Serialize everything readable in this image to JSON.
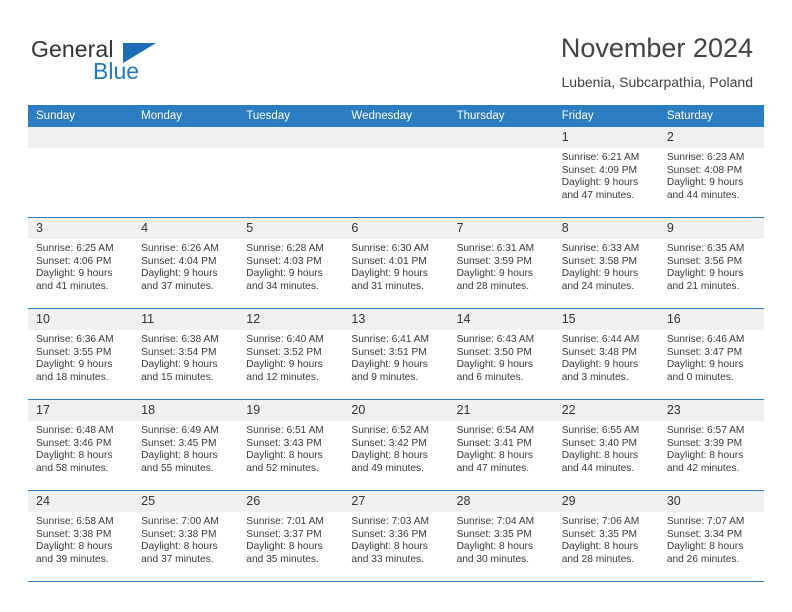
{
  "brand": {
    "name_top": "General",
    "name_bottom": "Blue",
    "triangle_color": "#1d6cb6",
    "blue_text_color": "#1f7ac4"
  },
  "header": {
    "title": "November 2024",
    "subtitle": "Lubenia, Subcarpathia, Poland"
  },
  "theme": {
    "header_blue": "#2b7cc0",
    "daynum_bg": "#f0f0f0",
    "text": "#333333"
  },
  "weekday_headers": [
    "Sunday",
    "Monday",
    "Tuesday",
    "Wednesday",
    "Thursday",
    "Friday",
    "Saturday"
  ],
  "weeks": [
    [
      {
        "day": "",
        "empty": true
      },
      {
        "day": "",
        "empty": true
      },
      {
        "day": "",
        "empty": true
      },
      {
        "day": "",
        "empty": true
      },
      {
        "day": "",
        "empty": true
      },
      {
        "day": "1",
        "sunrise": "Sunrise: 6:21 AM",
        "sunset": "Sunset: 4:09 PM",
        "daylight_1": "Daylight: 9 hours",
        "daylight_2": "and 47 minutes."
      },
      {
        "day": "2",
        "sunrise": "Sunrise: 6:23 AM",
        "sunset": "Sunset: 4:08 PM",
        "daylight_1": "Daylight: 9 hours",
        "daylight_2": "and 44 minutes."
      }
    ],
    [
      {
        "day": "3",
        "sunrise": "Sunrise: 6:25 AM",
        "sunset": "Sunset: 4:06 PM",
        "daylight_1": "Daylight: 9 hours",
        "daylight_2": "and 41 minutes."
      },
      {
        "day": "4",
        "sunrise": "Sunrise: 6:26 AM",
        "sunset": "Sunset: 4:04 PM",
        "daylight_1": "Daylight: 9 hours",
        "daylight_2": "and 37 minutes."
      },
      {
        "day": "5",
        "sunrise": "Sunrise: 6:28 AM",
        "sunset": "Sunset: 4:03 PM",
        "daylight_1": "Daylight: 9 hours",
        "daylight_2": "and 34 minutes."
      },
      {
        "day": "6",
        "sunrise": "Sunrise: 6:30 AM",
        "sunset": "Sunset: 4:01 PM",
        "daylight_1": "Daylight: 9 hours",
        "daylight_2": "and 31 minutes."
      },
      {
        "day": "7",
        "sunrise": "Sunrise: 6:31 AM",
        "sunset": "Sunset: 3:59 PM",
        "daylight_1": "Daylight: 9 hours",
        "daylight_2": "and 28 minutes."
      },
      {
        "day": "8",
        "sunrise": "Sunrise: 6:33 AM",
        "sunset": "Sunset: 3:58 PM",
        "daylight_1": "Daylight: 9 hours",
        "daylight_2": "and 24 minutes."
      },
      {
        "day": "9",
        "sunrise": "Sunrise: 6:35 AM",
        "sunset": "Sunset: 3:56 PM",
        "daylight_1": "Daylight: 9 hours",
        "daylight_2": "and 21 minutes."
      }
    ],
    [
      {
        "day": "10",
        "sunrise": "Sunrise: 6:36 AM",
        "sunset": "Sunset: 3:55 PM",
        "daylight_1": "Daylight: 9 hours",
        "daylight_2": "and 18 minutes."
      },
      {
        "day": "11",
        "sunrise": "Sunrise: 6:38 AM",
        "sunset": "Sunset: 3:54 PM",
        "daylight_1": "Daylight: 9 hours",
        "daylight_2": "and 15 minutes."
      },
      {
        "day": "12",
        "sunrise": "Sunrise: 6:40 AM",
        "sunset": "Sunset: 3:52 PM",
        "daylight_1": "Daylight: 9 hours",
        "daylight_2": "and 12 minutes."
      },
      {
        "day": "13",
        "sunrise": "Sunrise: 6:41 AM",
        "sunset": "Sunset: 3:51 PM",
        "daylight_1": "Daylight: 9 hours",
        "daylight_2": "and 9 minutes."
      },
      {
        "day": "14",
        "sunrise": "Sunrise: 6:43 AM",
        "sunset": "Sunset: 3:50 PM",
        "daylight_1": "Daylight: 9 hours",
        "daylight_2": "and 6 minutes."
      },
      {
        "day": "15",
        "sunrise": "Sunrise: 6:44 AM",
        "sunset": "Sunset: 3:48 PM",
        "daylight_1": "Daylight: 9 hours",
        "daylight_2": "and 3 minutes."
      },
      {
        "day": "16",
        "sunrise": "Sunrise: 6:46 AM",
        "sunset": "Sunset: 3:47 PM",
        "daylight_1": "Daylight: 9 hours",
        "daylight_2": "and 0 minutes."
      }
    ],
    [
      {
        "day": "17",
        "sunrise": "Sunrise: 6:48 AM",
        "sunset": "Sunset: 3:46 PM",
        "daylight_1": "Daylight: 8 hours",
        "daylight_2": "and 58 minutes."
      },
      {
        "day": "18",
        "sunrise": "Sunrise: 6:49 AM",
        "sunset": "Sunset: 3:45 PM",
        "daylight_1": "Daylight: 8 hours",
        "daylight_2": "and 55 minutes."
      },
      {
        "day": "19",
        "sunrise": "Sunrise: 6:51 AM",
        "sunset": "Sunset: 3:43 PM",
        "daylight_1": "Daylight: 8 hours",
        "daylight_2": "and 52 minutes."
      },
      {
        "day": "20",
        "sunrise": "Sunrise: 6:52 AM",
        "sunset": "Sunset: 3:42 PM",
        "daylight_1": "Daylight: 8 hours",
        "daylight_2": "and 49 minutes."
      },
      {
        "day": "21",
        "sunrise": "Sunrise: 6:54 AM",
        "sunset": "Sunset: 3:41 PM",
        "daylight_1": "Daylight: 8 hours",
        "daylight_2": "and 47 minutes."
      },
      {
        "day": "22",
        "sunrise": "Sunrise: 6:55 AM",
        "sunset": "Sunset: 3:40 PM",
        "daylight_1": "Daylight: 8 hours",
        "daylight_2": "and 44 minutes."
      },
      {
        "day": "23",
        "sunrise": "Sunrise: 6:57 AM",
        "sunset": "Sunset: 3:39 PM",
        "daylight_1": "Daylight: 8 hours",
        "daylight_2": "and 42 minutes."
      }
    ],
    [
      {
        "day": "24",
        "sunrise": "Sunrise: 6:58 AM",
        "sunset": "Sunset: 3:38 PM",
        "daylight_1": "Daylight: 8 hours",
        "daylight_2": "and 39 minutes."
      },
      {
        "day": "25",
        "sunrise": "Sunrise: 7:00 AM",
        "sunset": "Sunset: 3:38 PM",
        "daylight_1": "Daylight: 8 hours",
        "daylight_2": "and 37 minutes."
      },
      {
        "day": "26",
        "sunrise": "Sunrise: 7:01 AM",
        "sunset": "Sunset: 3:37 PM",
        "daylight_1": "Daylight: 8 hours",
        "daylight_2": "and 35 minutes."
      },
      {
        "day": "27",
        "sunrise": "Sunrise: 7:03 AM",
        "sunset": "Sunset: 3:36 PM",
        "daylight_1": "Daylight: 8 hours",
        "daylight_2": "and 33 minutes."
      },
      {
        "day": "28",
        "sunrise": "Sunrise: 7:04 AM",
        "sunset": "Sunset: 3:35 PM",
        "daylight_1": "Daylight: 8 hours",
        "daylight_2": "and 30 minutes."
      },
      {
        "day": "29",
        "sunrise": "Sunrise: 7:06 AM",
        "sunset": "Sunset: 3:35 PM",
        "daylight_1": "Daylight: 8 hours",
        "daylight_2": "and 28 minutes."
      },
      {
        "day": "30",
        "sunrise": "Sunrise: 7:07 AM",
        "sunset": "Sunset: 3:34 PM",
        "daylight_1": "Daylight: 8 hours",
        "daylight_2": "and 26 minutes."
      }
    ]
  ]
}
